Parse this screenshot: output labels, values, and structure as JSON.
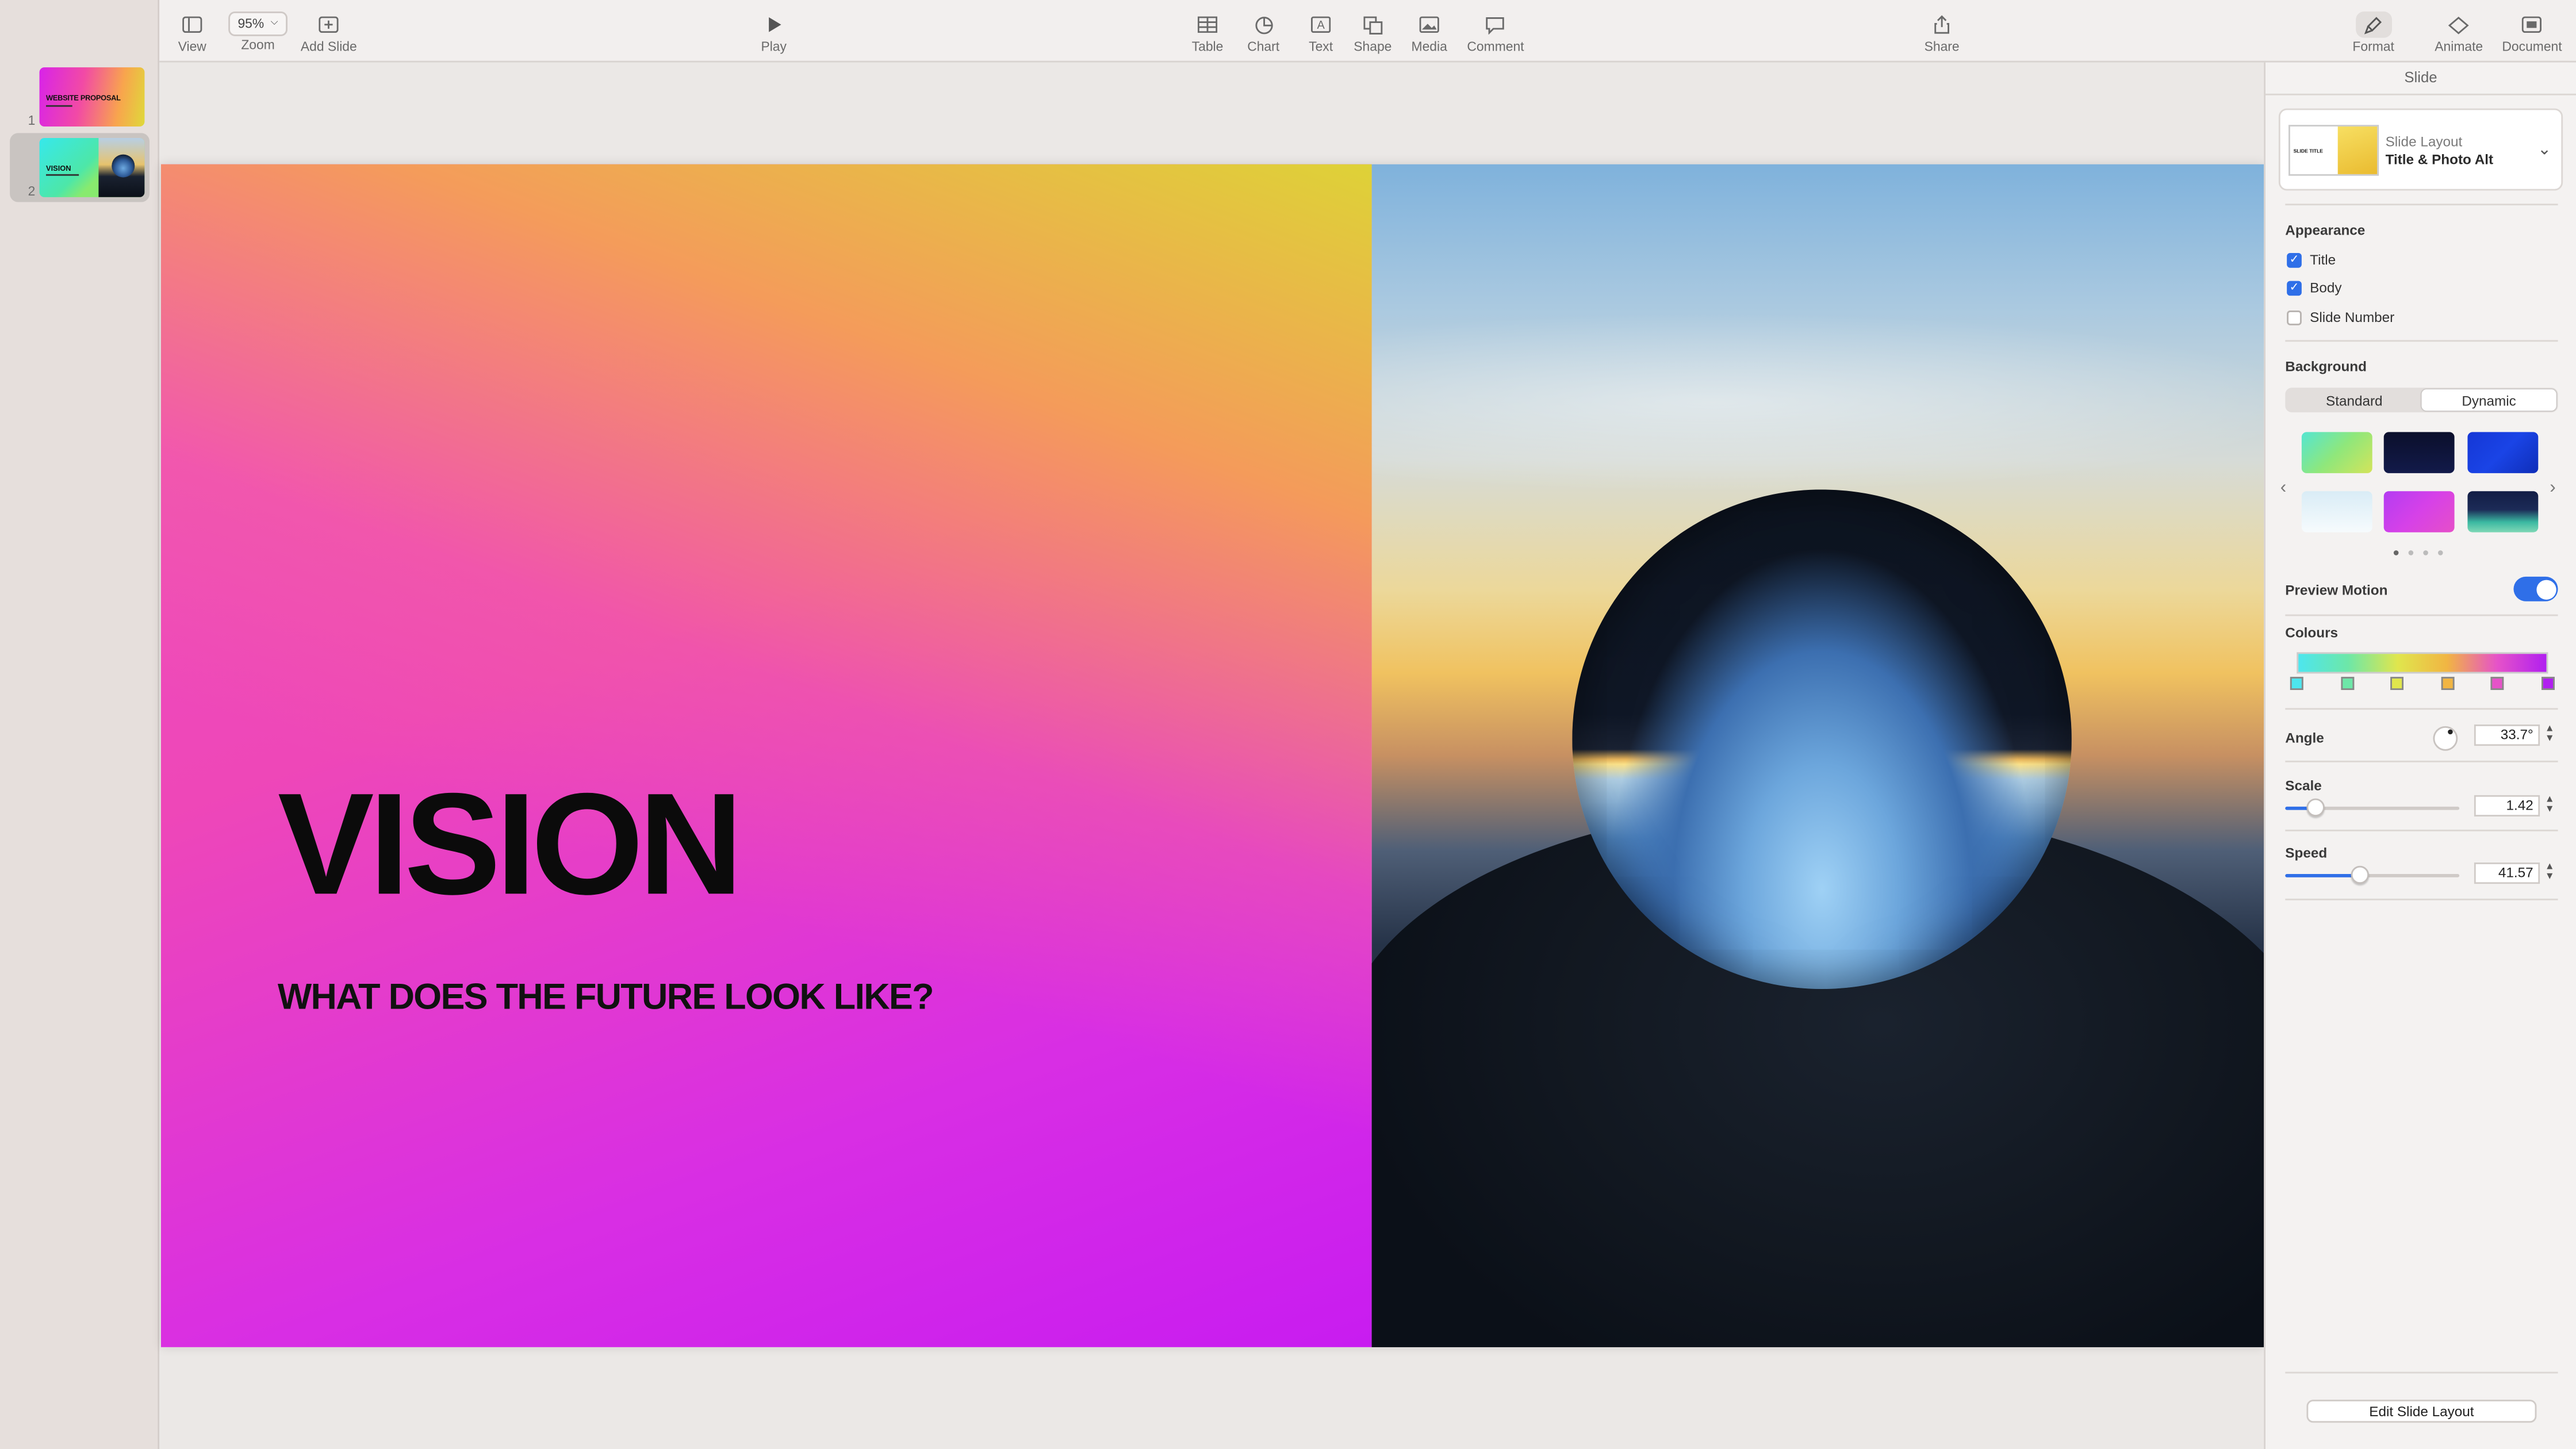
{
  "toolbar": {
    "view": "View",
    "zoom_value": "95%",
    "zoom": "Zoom",
    "add_slide": "Add Slide",
    "play": "Play",
    "table": "Table",
    "chart": "Chart",
    "text": "Text",
    "shape": "Shape",
    "media": "Media",
    "comment": "Comment",
    "share": "Share",
    "format": "Format",
    "animate": "Animate",
    "document": "Document"
  },
  "navigator": {
    "slides": [
      {
        "number": "1",
        "thumb_title": "WEBSITE PROPOSAL"
      },
      {
        "number": "2",
        "thumb_title": "VISION",
        "selected": true
      }
    ]
  },
  "slide": {
    "title": "VISION",
    "subtitle": "WHAT DOES THE FUTURE LOOK LIKE?"
  },
  "inspector": {
    "header": "Slide",
    "layout_caption": "Slide Layout",
    "layout_name": "Title & Photo Alt",
    "layout_thumb_text": "SLIDE TITLE",
    "appearance_title": "Appearance",
    "appearance": [
      {
        "label": "Title",
        "checked": true
      },
      {
        "label": "Body",
        "checked": true
      },
      {
        "label": "Slide Number",
        "checked": false
      }
    ],
    "background_title": "Background",
    "background_tabs": [
      "Standard",
      "Dynamic"
    ],
    "background_active_tab": "Dynamic",
    "swatches": [
      "#6de7b0",
      "#0c1030",
      "#1238d8",
      "#e6f2f8",
      "#c33ff0",
      "#1b2650"
    ],
    "page_dots": 4,
    "preview_motion": "Preview Motion",
    "preview_motion_on": true,
    "colours_title": "Colours",
    "colour_stops": [
      "#4de6ee",
      "#6de7a8",
      "#e0e64d",
      "#f1b543",
      "#e653c8",
      "#b11ff0"
    ],
    "angle_label": "Angle",
    "angle_value": "33.7°",
    "scale_label": "Scale",
    "scale_value": "1.42",
    "scale_level": 0.17,
    "speed_label": "Speed",
    "speed_value": "41.57",
    "speed_level": 0.42,
    "edit_layout": "Edit Slide Layout"
  }
}
